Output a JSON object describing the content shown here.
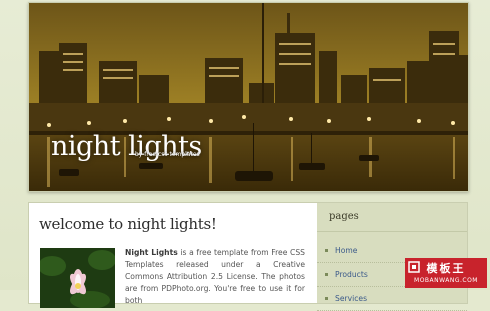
{
  "header": {
    "site_title": "night lights",
    "site_subtitle": "by free css templates"
  },
  "content": {
    "heading": "welcome to night lights!",
    "intro_bold": "Night Lights",
    "intro_text": " is a free template from Free CSS Templates released under a Creative Commons Attribution 2.5 License. The photos are from PDPhoto.org. You're free to use it for both"
  },
  "sidebar": {
    "heading": "pages",
    "items": [
      {
        "label": "Home"
      },
      {
        "label": "Products"
      },
      {
        "label": "Services"
      }
    ]
  },
  "watermark": {
    "top": "模板王",
    "bottom": "MOBANWANG.COM"
  },
  "colors": {
    "background": "#e4e9cf",
    "sidebar": "#d8ddbf",
    "link": "#3b5a8a",
    "logo": "#c8232c"
  }
}
